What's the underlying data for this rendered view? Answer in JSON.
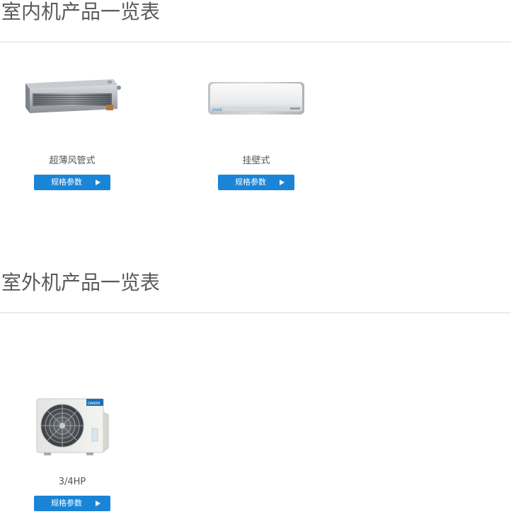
{
  "indoor": {
    "title": "室内机产品一览表",
    "products": [
      {
        "name": "超薄风管式",
        "button_label": "规格参数",
        "icon": "ducted-unit-image"
      },
      {
        "name": "挂壁式",
        "button_label": "规格参数",
        "icon": "wall-mounted-unit-image"
      }
    ]
  },
  "outdoor": {
    "title": "室外机产品一览表",
    "products": [
      {
        "name": "3/4HP",
        "button_label": "规格参数",
        "icon": "outdoor-unit-image"
      }
    ]
  },
  "colors": {
    "button": "#1a85d6",
    "title": "#5a5a5a",
    "divider": "#dcdcdc"
  }
}
